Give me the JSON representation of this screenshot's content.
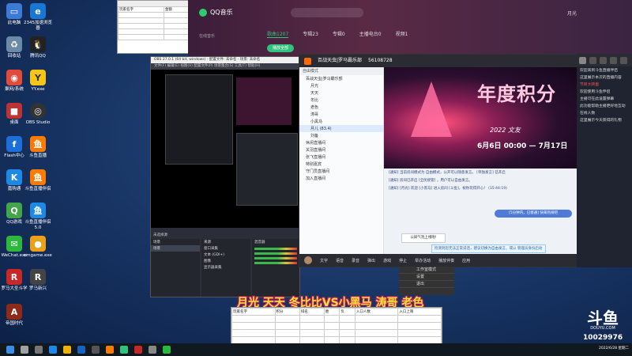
{
  "desktop": {
    "icons_col1": [
      "此电脑",
      "回收站",
      "聚网/系统",
      "桌面",
      "Flash中心",
      "嘉购通",
      "QQ游戏",
      "WeChat.exe",
      "罗马大圣斗学",
      "帝国时代"
    ],
    "icons_col2": [
      "2345加速浏览器",
      "腾讯QQ",
      "YY.exe",
      "OBS Studio",
      "斗鱼直播",
      "斗鱼直播伴侣",
      "斗鱼直播伴侣5.0",
      "cmgame.exe",
      "罗马新兴"
    ]
  },
  "qqmusic": {
    "app_name": "QQ音乐",
    "tabs": [
      "歌曲1207",
      "专辑23",
      "专辑0",
      "主播电台0",
      "视频1"
    ],
    "sidebar_label": "在线音乐",
    "play_button": "播放全部",
    "user": "月光"
  },
  "sheet_top": {
    "headers": [
      "玩家名字",
      "金额"
    ]
  },
  "obs": {
    "title": "OBS 27.0.1 (64 bit, windows) - 配置文件: 未命名 - 场景: 未命名",
    "menu": "文件(F)  编辑(E)  视图(V)  配置文件(P)  场景集合(S)  工具(T)  帮助(H)",
    "panel_scenes": "场景",
    "panel_sources": "来源",
    "panel_mixer": "混音器",
    "no_source": "未选择源",
    "scenes": [
      "场景"
    ],
    "sources": [
      "窗口采集",
      "文本 (GDI+)",
      "图像",
      "显示器采集"
    ]
  },
  "douyu": {
    "room_title": "百战天虫|罗马霸乐部",
    "room_id": "56108728",
    "channel_header": "自由模式",
    "channels": [
      "百战天虫|罗马霸乐部",
      "月光",
      "天天",
      "冬比",
      "老色",
      "涛哥",
      "小黑马",
      "月儿 (83.4)",
      "刘备",
      "休闲直播间",
      "关羽直播间",
      "张飞直播间",
      "特别嘉宾",
      "守门员直播间",
      "加入直播间"
    ],
    "banner_title": "年度积分",
    "banner_year": "2022 文友",
    "banner_dates": "6月6日 00:00 — 7月17日",
    "messages": [
      "[通知] 当前房间模式为 自由模式，公开可以随意发言。 [单独发言] 已开启",
      "[通知] 房间已开启 [全民接管] ，用户可以自由发言。",
      "[通知] [月光] 欢迎 [小黑马] 进入房间 [斗鱼]，祝你玩得开心！ (15:44:19)"
    ],
    "bubble": "[5分钟内，已接通] 快来热闹吧",
    "popup": "公屏气泡上线啦!",
    "notice": "检测到您无法正常说话，建议切换为自由发言，或以 管理员身份启动",
    "bottom_items": [
      "文字",
      "语音",
      "录音",
      "弹出",
      "游戏",
      "停止",
      "举办活动",
      "播放伴奏",
      "应用"
    ]
  },
  "right_panel": {
    "texts": [
      "欢迎来到斗鱼直播伴侣",
      "这里展示本次的直播内容",
      "节目大转盘",
      "欢迎使用斗鱼伴侣",
      "主播可在此设置弹幕",
      "此功能帮助主播更好地互动",
      "在线人数",
      "这里展示今天获得的礼物"
    ]
  },
  "context_menu": [
    "工作室模式",
    "设置",
    "退出"
  ],
  "sheet_bottom": {
    "headers": [
      "玩家名字",
      "积分",
      "排名",
      "胜",
      "负",
      "入口人数",
      "入口上限"
    ]
  },
  "subtitle": "月光 天天 冬比比VS小黑马 涛哥 老色",
  "watermark": {
    "logo": "斗鱼",
    "site": "DOUYU.COM",
    "room": "10029976"
  },
  "taskbar": {
    "time": "2022/6/28 星期二"
  }
}
